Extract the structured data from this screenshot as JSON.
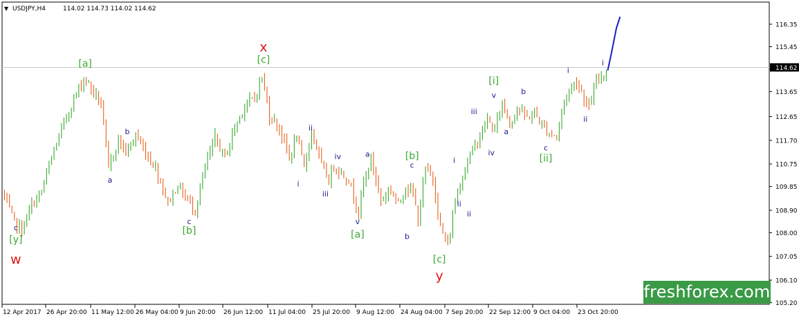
{
  "chart_data": {
    "type": "candlestick",
    "header": {
      "symbol": "USDJPY,H4",
      "ohlc": "114.02 114.73 114.02 114.62",
      "arrow": "▼"
    },
    "current_price": "114.62",
    "ylim": [
      105.2,
      117.4
    ],
    "y_ticks": [
      "116.35",
      "115.45",
      "114.55",
      "113.65",
      "112.65",
      "111.70",
      "110.75",
      "109.85",
      "108.90",
      "108.00",
      "107.05",
      "106.10",
      "105.20"
    ],
    "x_ticks": [
      "12 Apr 2017",
      "26 Apr 20:00",
      "11 May 12:00",
      "26 May 04:00",
      "9 Jun 20:00",
      "26 Jun 12:00",
      "11 Jul 04:00",
      "25 Jul 20:00",
      "9 Aug 12:00",
      "24 Aug 04:00",
      "7 Sep 20:00",
      "22 Sep 12:00",
      "9 Oct 04:00",
      "23 Oct 20:00"
    ],
    "colors": {
      "up": "#3aa82e",
      "down": "#e8601c",
      "projection": "#1c1cc8",
      "red_label": "#e01818",
      "green_label": "#3aa82e",
      "blue_label": "#1c1c8c",
      "axis": "#000000",
      "price_line": "#c8c8c8"
    },
    "path": [
      [
        0,
        109.65
      ],
      [
        5,
        108.4
      ],
      [
        8,
        108.1
      ],
      [
        12,
        109.1
      ],
      [
        16,
        109.65
      ],
      [
        20,
        111.0
      ],
      [
        25,
        112.4
      ],
      [
        29,
        113.35
      ],
      [
        33,
        114.2
      ],
      [
        36,
        113.8
      ],
      [
        40,
        113.15
      ],
      [
        43,
        110.55
      ],
      [
        47,
        111.75
      ],
      [
        50,
        111.2
      ],
      [
        54,
        111.9
      ],
      [
        58,
        111.2
      ],
      [
        62,
        110.6
      ],
      [
        67,
        109.2
      ],
      [
        71,
        109.9
      ],
      [
        75,
        109.3
      ],
      [
        78,
        108.9
      ],
      [
        82,
        110.6
      ],
      [
        86,
        111.8
      ],
      [
        90,
        111.0
      ],
      [
        94,
        112.2
      ],
      [
        98,
        113.1
      ],
      [
        102,
        113.4
      ],
      [
        105,
        114.25
      ],
      [
        108,
        112.7
      ],
      [
        112,
        112.2
      ],
      [
        116,
        111.0
      ],
      [
        119,
        111.85
      ],
      [
        122,
        110.55
      ],
      [
        125,
        112.1
      ],
      [
        129,
        110.7
      ],
      [
        132,
        110.1
      ],
      [
        134,
        110.7
      ],
      [
        137,
        110.4
      ],
      [
        140,
        110.1
      ],
      [
        144,
        108.85
      ],
      [
        146,
        110.0
      ],
      [
        149,
        110.95
      ],
      [
        153,
        109.3
      ],
      [
        157,
        109.75
      ],
      [
        160,
        109.1
      ],
      [
        163,
        109.9
      ],
      [
        166,
        109.55
      ],
      [
        168,
        108.5
      ],
      [
        171,
        110.55
      ],
      [
        174,
        110.2
      ],
      [
        177,
        108.2
      ],
      [
        180,
        107.45
      ],
      [
        183,
        109.3
      ],
      [
        187,
        110.65
      ],
      [
        190,
        111.3
      ],
      [
        193,
        111.9
      ],
      [
        196,
        112.5
      ],
      [
        199,
        112.1
      ],
      [
        202,
        113.25
      ],
      [
        205,
        112.35
      ],
      [
        208,
        113.0
      ],
      [
        212,
        112.6
      ],
      [
        215,
        112.8
      ],
      [
        218,
        112.3
      ],
      [
        221,
        112.0
      ],
      [
        224,
        111.85
      ],
      [
        227,
        113.3
      ],
      [
        230,
        113.85
      ],
      [
        232,
        114.1
      ],
      [
        235,
        113.4
      ],
      [
        237,
        113.0
      ],
      [
        240,
        114.05
      ],
      [
        244,
        114.5
      ]
    ],
    "projection": [
      [
        244,
        114.5
      ],
      [
        245.5,
        115.2
      ],
      [
        247.5,
        116.2
      ],
      [
        249,
        116.65
      ]
    ],
    "wave_labels": [
      {
        "t": "w",
        "i": 5,
        "p": 106.75,
        "c": "red_label",
        "s": 19
      },
      {
        "t": "[y]",
        "i": 5,
        "p": 107.6,
        "c": "green_label",
        "s": 14
      },
      {
        "t": "c",
        "i": 5,
        "p": 108.1,
        "c": "blue_label",
        "s": 11
      },
      {
        "t": "[a]",
        "i": 33,
        "p": 114.65,
        "c": "green_label",
        "s": 14
      },
      {
        "t": "a",
        "i": 43,
        "p": 110.0,
        "c": "blue_label",
        "s": 11
      },
      {
        "t": "b",
        "i": 50,
        "p": 111.95,
        "c": "blue_label",
        "s": 11
      },
      {
        "t": "c",
        "i": 75,
        "p": 108.35,
        "c": "blue_label",
        "s": 11
      },
      {
        "t": "[b]",
        "i": 75,
        "p": 107.95,
        "c": "green_label",
        "s": 14
      },
      {
        "t": "x",
        "i": 105,
        "p": 115.25,
        "c": "red_label",
        "s": 19
      },
      {
        "t": "[c]",
        "i": 105,
        "p": 114.8,
        "c": "green_label",
        "s": 14
      },
      {
        "t": "i",
        "i": 119,
        "p": 109.85,
        "c": "blue_label",
        "s": 11
      },
      {
        "t": "ii",
        "i": 124,
        "p": 112.1,
        "c": "blue_label",
        "s": 11
      },
      {
        "t": "iii",
        "i": 130,
        "p": 109.45,
        "c": "blue_label",
        "s": 11
      },
      {
        "t": "iv",
        "i": 135,
        "p": 110.95,
        "c": "blue_label",
        "s": 11
      },
      {
        "t": "a",
        "i": 147,
        "p": 111.05,
        "c": "blue_label",
        "s": 11
      },
      {
        "t": "v",
        "i": 143,
        "p": 108.35,
        "c": "blue_label",
        "s": 11
      },
      {
        "t": "[a]",
        "i": 143,
        "p": 107.8,
        "c": "green_label",
        "s": 14
      },
      {
        "t": "b",
        "i": 163,
        "p": 107.75,
        "c": "blue_label",
        "s": 11
      },
      {
        "t": "c",
        "i": 165,
        "p": 110.6,
        "c": "blue_label",
        "s": 11
      },
      {
        "t": "[b]",
        "i": 165,
        "p": 110.95,
        "c": "green_label",
        "s": 14
      },
      {
        "t": "[c]",
        "i": 176,
        "p": 106.8,
        "c": "green_label",
        "s": 14
      },
      {
        "t": "y",
        "i": 176,
        "p": 106.1,
        "c": "red_label",
        "s": 19
      },
      {
        "t": "i",
        "i": 182,
        "p": 110.8,
        "c": "blue_label",
        "s": 11
      },
      {
        "t": "ii",
        "i": 184,
        "p": 109.05,
        "c": "blue_label",
        "s": 11
      },
      {
        "t": "ii",
        "i": 188,
        "p": 108.65,
        "c": "blue_label",
        "s": 11
      },
      {
        "t": "iii",
        "i": 190,
        "p": 112.75,
        "c": "blue_label",
        "s": 11
      },
      {
        "t": "iv",
        "i": 197,
        "p": 111.1,
        "c": "blue_label",
        "s": 11
      },
      {
        "t": "[i]",
        "i": 198,
        "p": 113.95,
        "c": "green_label",
        "s": 14
      },
      {
        "t": "v",
        "i": 198,
        "p": 113.4,
        "c": "blue_label",
        "s": 11
      },
      {
        "t": "a",
        "i": 203,
        "p": 111.95,
        "c": "blue_label",
        "s": 11
      },
      {
        "t": "b",
        "i": 210,
        "p": 113.55,
        "c": "blue_label",
        "s": 11
      },
      {
        "t": "c",
        "i": 219,
        "p": 111.3,
        "c": "blue_label",
        "s": 11
      },
      {
        "t": "[ii]",
        "i": 219,
        "p": 110.85,
        "c": "green_label",
        "s": 14
      },
      {
        "t": "i",
        "i": 228,
        "p": 114.4,
        "c": "blue_label",
        "s": 11
      },
      {
        "t": "ii",
        "i": 235,
        "p": 112.45,
        "c": "blue_label",
        "s": 11
      },
      {
        "t": "i",
        "i": 242,
        "p": 114.7,
        "c": "blue_label",
        "s": 11
      }
    ],
    "xlabel": "",
    "ylabel": ""
  },
  "watermark": "freshforex.com"
}
